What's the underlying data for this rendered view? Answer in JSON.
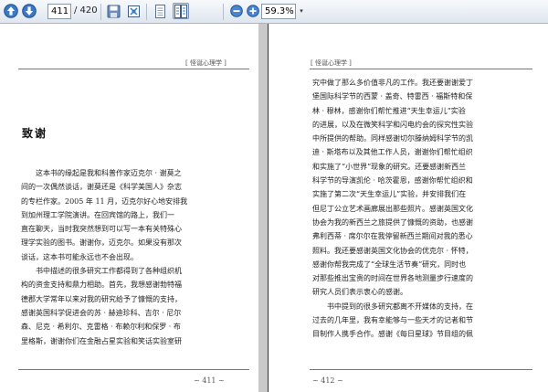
{
  "toolbar": {
    "page_current": "411",
    "page_total": "/ 420",
    "zoom": "59.3%",
    "zoom_dropdown_icon": "▾",
    "buttons": [
      "prev-page",
      "next-page",
      "save",
      "fit-page",
      "single-page-view",
      "two-page-view",
      "zoom-out",
      "zoom-in"
    ]
  },
  "left_page": {
    "running_head": "[ 怪诞心理学 ]",
    "chapter_title": "致谢",
    "lines": [
      {
        "text": "这本书的缘起是我和科普作家迈克尔 · 谢莫之",
        "indent": true
      },
      {
        "text": "间的一次偶然谈话，谢莫还是《科学美国人》杂志",
        "indent": false
      },
      {
        "text": "的专栏作家。2005 年 11 月，迈克尔好心地安排我",
        "indent": false
      },
      {
        "text": "到加州理工学院演讲。在回宾馆的路上，我们一",
        "indent": false
      },
      {
        "text": "直在聊天，当时我突然想到可以写一本有关特殊心",
        "indent": false
      },
      {
        "text": "理学实验的图书。谢谢你，迈克尔。如果没有那次",
        "indent": false
      },
      {
        "text": "谈话，这本书可能永远也不会出现。",
        "indent": false
      },
      {
        "text": "书中描述的很多研究工作都得到了各种组织机",
        "indent": true
      },
      {
        "text": "构的资金支持和鼎力相助。首先，我想感谢勃特福",
        "indent": false
      },
      {
        "text": "德郡大学常年以来对我的研究给予了慷慨的支持，",
        "indent": false
      },
      {
        "text": "感谢英国科学促进会的苏 · 赫迪珍科、吉尔 · 尼尔",
        "indent": false
      },
      {
        "text": "森、尼克 · 希利尔、克雷格 · 布赖尔利和保罗 · 布",
        "indent": false
      },
      {
        "text": "里格斯，谢谢你们在金融占星实验和笑话实验室研",
        "indent": false
      }
    ],
    "page_number": "~ 411 ~"
  },
  "right_page": {
    "running_head": "[ 怪诞心理学 ]",
    "lines": [
      {
        "text": "究中做了那么多价值非凡的工作。我还要谢谢爱丁",
        "indent": false
      },
      {
        "text": "堡国际科学节的西蒙 · 盖奇、特雷西 · 福斯特和保",
        "indent": false
      },
      {
        "text": "林 · 穆林，感谢你们帮忙推进“天生幸运儿”实验",
        "indent": false
      },
      {
        "text": "的进展，以及在微笑科学和闪电约会的探究性实验",
        "indent": false
      },
      {
        "text": "中所提供的帮助。同样感谢切尔滕纳姆科学节的凯",
        "indent": false
      },
      {
        "text": "迪 · 斯塔布以及其他工作人员，谢谢你们帮忙组织",
        "indent": false
      },
      {
        "text": "和实施了“小世界”现象的研究。还要感谢新西兰",
        "indent": false
      },
      {
        "text": "科学节的导演凯伦 · 哈茨霍恩，感谢你帮忙组织和",
        "indent": false
      },
      {
        "text": "实施了第二次“天生幸运儿”实验，并安排我们在",
        "indent": false
      },
      {
        "text": "但尼丁公立艺术画廊展出那些照片。感谢英国文化",
        "indent": false
      },
      {
        "text": "协会为我的新西兰之旅提供了慷慨的资助，也感谢",
        "indent": false
      },
      {
        "text": "弗利西蒂 · 席尔尔在我停留新西兰期间对我的悉心",
        "indent": false
      },
      {
        "text": "照料。我还要感谢英国文化协会的优克尔 · 怀特，",
        "indent": false
      },
      {
        "text": "感谢你帮我完成了“全球生活节奏”研究，同时也",
        "indent": false
      },
      {
        "text": "对那些推出宝贵的时间在世界各地测量步行速度的",
        "indent": false
      },
      {
        "text": "研究人员们表示衷心的感谢。",
        "indent": false
      },
      {
        "text": "书中提到的很多研究都离不开媒体的支持，在",
        "indent": true
      },
      {
        "text": "过去的几年里，我有幸能够与一些天才的记者和节",
        "indent": false
      },
      {
        "text": "目制作人携手合作。感谢《每日星球》节目组的佩",
        "indent": false
      }
    ],
    "page_number": "~ 412 ~"
  }
}
